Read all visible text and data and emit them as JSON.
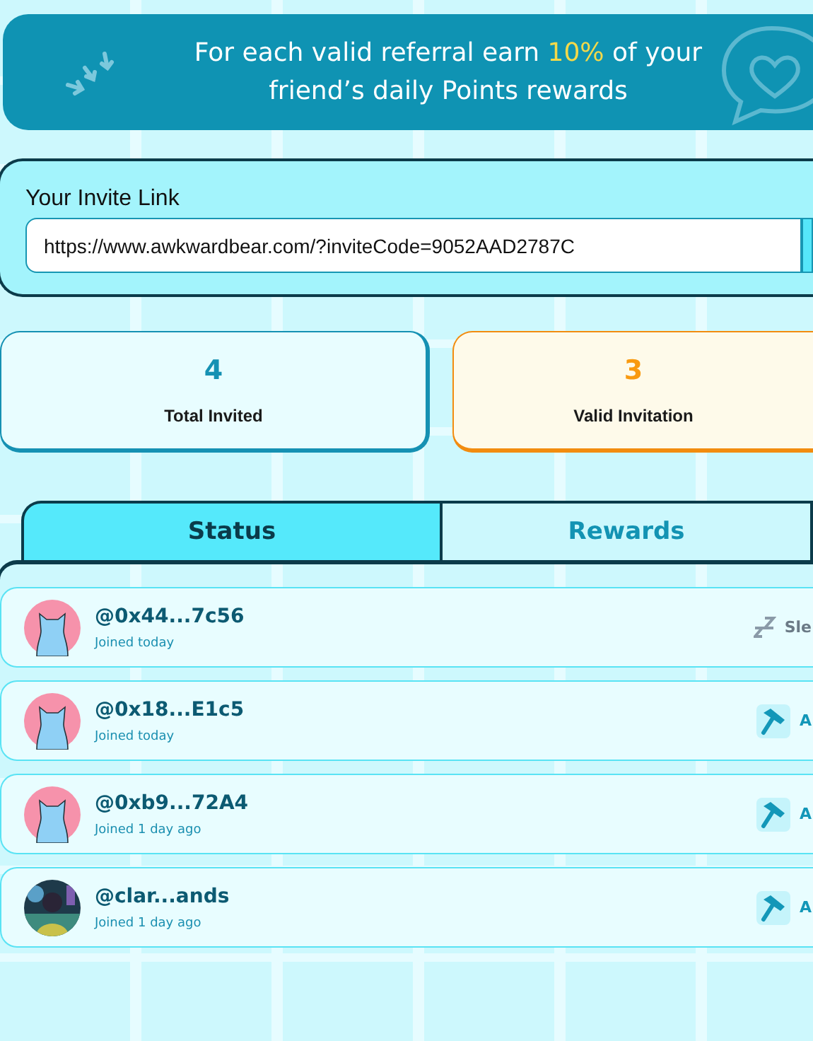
{
  "banner": {
    "text": "For each valid referral earn **10%** of your friend’s daily Points rewards"
  },
  "invite": {
    "label": "Your Invite Link",
    "value": "https://www.awkwardbear.com/?inviteCode=9052AAD2787C"
  },
  "stats": [
    {
      "value": "4",
      "label": "Total Invited",
      "kind": "total"
    },
    {
      "value": "3",
      "label": "Valid Invitation",
      "kind": "valid"
    }
  ],
  "tabs": [
    {
      "label": "Status",
      "selected": true
    },
    {
      "label": "Rewards",
      "selected": false
    }
  ],
  "referrals": [
    {
      "handle": "@0x44...7c56",
      "joined": "Joined today",
      "kind": "cat",
      "status": {
        "kind": "sleep",
        "label": "Sle"
      }
    },
    {
      "handle": "@0x18...E1c5",
      "joined": "Joined today",
      "kind": "cat",
      "status": {
        "kind": "active",
        "label": "A"
      }
    },
    {
      "handle": "@0xb9...72A4",
      "joined": "Joined 1 day ago",
      "kind": "cat",
      "status": {
        "kind": "active",
        "label": "A"
      }
    },
    {
      "handle": "@clar...ands",
      "joined": "Joined 1 day ago",
      "kind": "picture",
      "status": {
        "kind": "active",
        "label": "A"
      }
    }
  ]
}
